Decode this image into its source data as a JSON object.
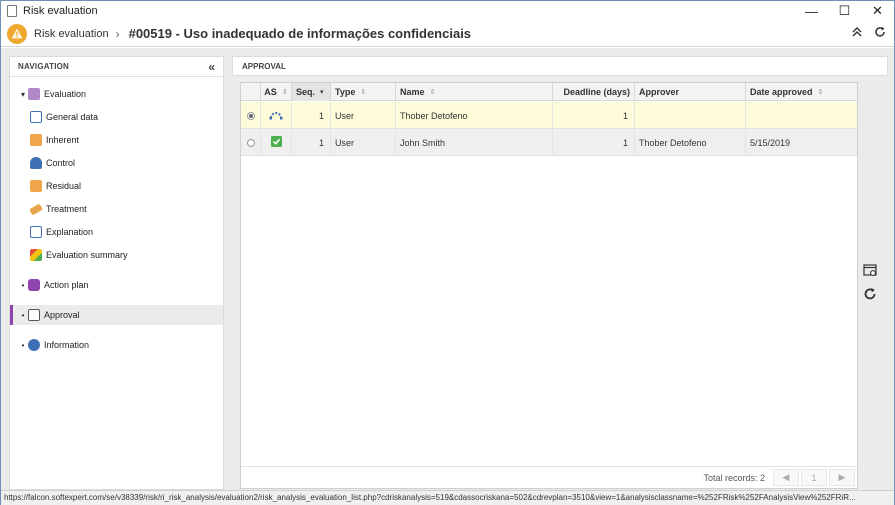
{
  "window": {
    "title": "Risk evaluation",
    "controls": {
      "minimize": "—",
      "maximize": "☐",
      "close": "✕"
    }
  },
  "header": {
    "breadcrumb": "Risk evaluation",
    "title": "#00519 - Uso inadequado de informações confidenciais",
    "icons": [
      "collapse-up-icon",
      "refresh-icon"
    ]
  },
  "navigation": {
    "heading": "NAVIGATION",
    "items": [
      {
        "label": "Evaluation",
        "icon": "evaluation-icon",
        "level": 0,
        "expanded": true
      },
      {
        "label": "General data",
        "icon": "general-data-icon",
        "level": 1
      },
      {
        "label": "Inherent",
        "icon": "inherent-icon",
        "level": 1
      },
      {
        "label": "Control",
        "icon": "control-icon",
        "level": 1
      },
      {
        "label": "Residual",
        "icon": "residual-icon",
        "level": 1
      },
      {
        "label": "Treatment",
        "icon": "treatment-icon",
        "level": 1
      },
      {
        "label": "Explanation",
        "icon": "explanation-icon",
        "level": 1
      },
      {
        "label": "Evaluation summary",
        "icon": "evaluation-summary-icon",
        "level": 1
      },
      {
        "label": "Action plan",
        "icon": "action-plan-icon",
        "level": 0
      },
      {
        "label": "Approval",
        "icon": "approval-icon",
        "level": 0,
        "selected": true
      },
      {
        "label": "Information",
        "icon": "information-icon",
        "level": 0
      }
    ]
  },
  "main": {
    "heading": "APPROVAL",
    "columns": [
      "AS",
      "Seq.",
      "Type",
      "Name",
      "Deadline (days)",
      "Approver",
      "Date approved"
    ],
    "rows": [
      {
        "selected": true,
        "as_icon": "in-progress-icon",
        "seq": "1",
        "type": "User",
        "name": "Thober Detofeno",
        "deadline": "1",
        "approver": "",
        "date": ""
      },
      {
        "selected": false,
        "as_icon": "approved-check-icon",
        "seq": "1",
        "type": "User",
        "name": "John Smith",
        "deadline": "1",
        "approver": "Thober Detofeno",
        "date": "5/15/2019"
      }
    ],
    "footer": {
      "total": "Total records: 2",
      "page": "1"
    }
  },
  "status_bar": {
    "url": "https://falcon.softexpert.com/se/v38339/risk/ri_risk_analysis/evaluation2/risk_analysis_evaluation_list.php?cdriskanalysis=519&cdassocriskana=502&cdrevplan=3510&view=1&analysisclassname=%252FRisk%252FAnalysisView%252FRiR..."
  },
  "colors": {
    "accent": "#8e44ad",
    "warning": "#f0a72e",
    "selected_row": "#fdfbd8",
    "check": "#4caf50"
  }
}
